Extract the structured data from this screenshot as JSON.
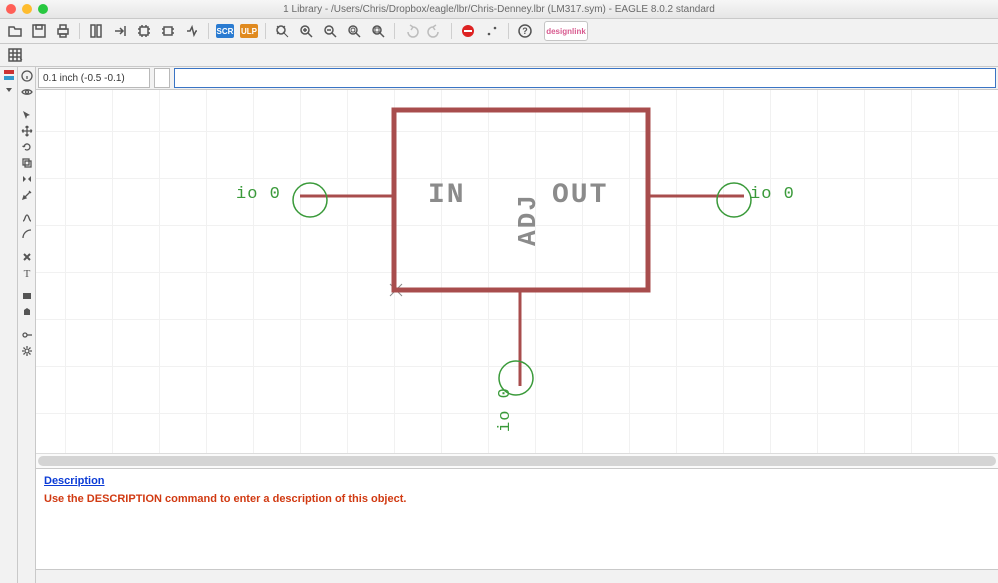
{
  "window": {
    "title": "1 Library - /Users/Chris/Dropbox/eagle/lbr/Chris-Denney.lbr (LM317.sym) - EAGLE 8.0.2 standard",
    "traffic": {
      "close": "#ff5f57",
      "min": "#febc2e",
      "max": "#28c840"
    }
  },
  "toolbar": {
    "chips": {
      "scr": {
        "label": "SCR",
        "bg": "#2a7bd1"
      },
      "ulp": {
        "label": "ULP",
        "bg": "#e08a1f"
      }
    },
    "stop_color": "#d22",
    "designlink": "designlink"
  },
  "coord": {
    "text": "0.1 inch (-0.5 -0.1)",
    "cmd": ""
  },
  "schematic": {
    "pins": {
      "in": {
        "label": "io 0"
      },
      "out": {
        "label": "io 0"
      },
      "adj": {
        "label": "io 0"
      }
    },
    "body": {
      "in": "IN",
      "out": "OUT",
      "adj": "ADJ"
    },
    "colors": {
      "outline": "#a84d4d",
      "pin": "#3a9a3a",
      "origin": "#888"
    }
  },
  "description": {
    "heading": "Description",
    "message": "Use the DESCRIPTION command to enter a description of this object."
  },
  "status": {
    "text": " "
  }
}
